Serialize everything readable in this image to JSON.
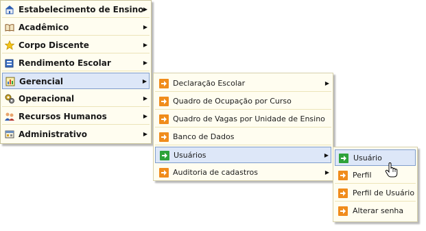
{
  "main_menu": {
    "items": [
      {
        "label": "Estabelecimento de Ensino",
        "icon": "school-house-icon"
      },
      {
        "label": "Acadêmico",
        "icon": "open-book-icon"
      },
      {
        "label": "Corpo Discente",
        "icon": "star-icon"
      },
      {
        "label": "Rendimento Escolar",
        "icon": "report-card-icon"
      },
      {
        "label": "Gerencial",
        "icon": "manager-chart-icon",
        "active": true
      },
      {
        "label": "Operacional",
        "icon": "gears-icon"
      },
      {
        "label": "Recursos Humanos",
        "icon": "people-icon"
      },
      {
        "label": "Administrativo",
        "icon": "admin-window-icon"
      }
    ]
  },
  "gerencial_submenu": {
    "items": [
      {
        "label": "Declaração Escolar",
        "has_submenu": true
      },
      {
        "label": "Quadro de Ocupação por Curso"
      },
      {
        "label": "Quadro de Vagas por Unidade de Ensino"
      },
      {
        "label": "Banco de Dados"
      },
      {
        "label": "Usuários",
        "has_submenu": true,
        "active": true
      },
      {
        "label": "Auditoria de cadastros",
        "has_submenu": true
      }
    ]
  },
  "usuarios_submenu": {
    "items": [
      {
        "label": "Usuário",
        "active": true
      },
      {
        "label": "Perfil"
      },
      {
        "label": "Perfil de Usuário"
      },
      {
        "label": "Alterar senha"
      }
    ]
  },
  "colors": {
    "menu_background": "#fffdf0",
    "menu_border": "#c9c39a",
    "active_background": "#dde7f8",
    "active_border": "#7f9dcc",
    "arrow_orange": "#f08c1c",
    "arrow_green": "#2ea23a"
  }
}
